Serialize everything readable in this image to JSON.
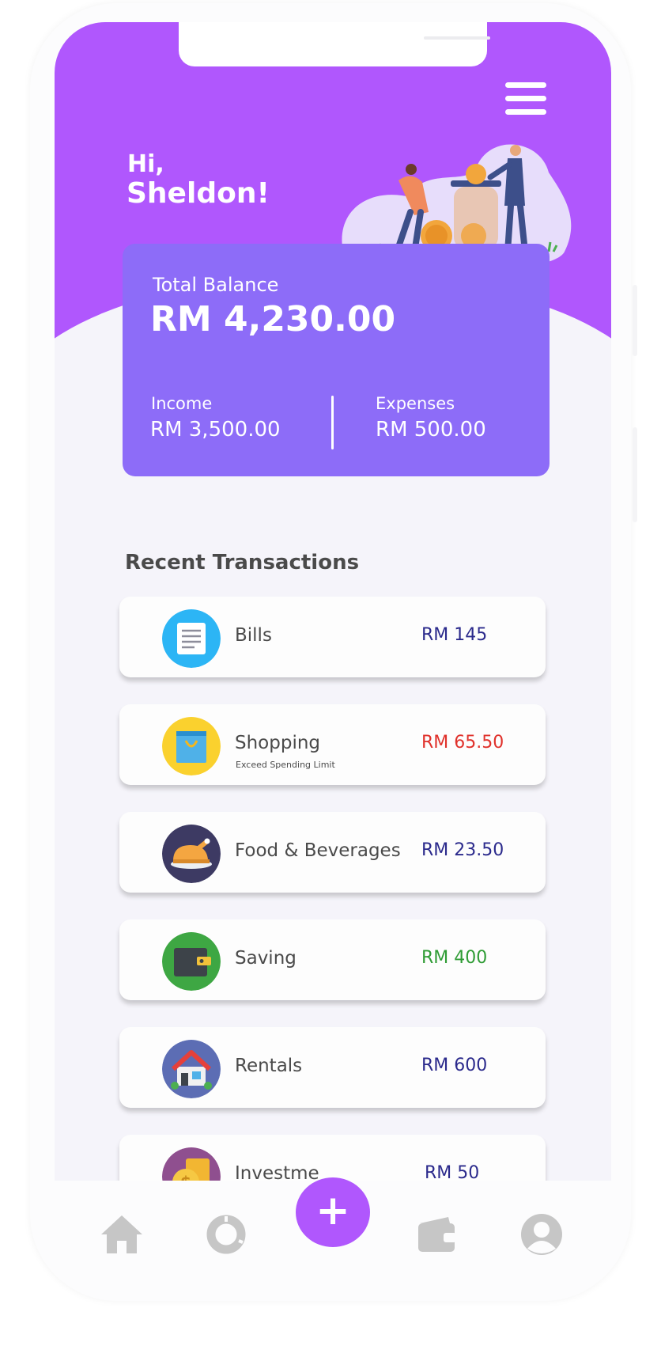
{
  "greeting": {
    "hi": "Hi,",
    "name": "Sheldon!"
  },
  "balance": {
    "label": "Total Balance",
    "value": "RM 4,230.00",
    "income_label": "Income",
    "income_value": "RM 3,500.00",
    "expenses_label": "Expenses",
    "expenses_value": "RM 500.00"
  },
  "recent": {
    "title": "Recent Transactions",
    "items": [
      {
        "name": "Bills",
        "amount": "RM 145",
        "amount_color": "#2b2a8c",
        "icon": "bills-icon",
        "icon_color": "#2cb5f5"
      },
      {
        "name": "Shopping",
        "sub": "Exceed Spending Limit",
        "amount": "RM 65.50",
        "amount_color": "#e0312b",
        "icon": "shopping-bag-icon",
        "icon_color": "#fad12e"
      },
      {
        "name": "Food & Beverages",
        "amount": "RM 23.50",
        "amount_color": "#2b2a8c",
        "icon": "roast-chicken-icon",
        "icon_color": "#3d3a63"
      },
      {
        "name": "Saving",
        "amount": "RM 400",
        "amount_color": "#2f9c35",
        "icon": "wallet-icon",
        "icon_color": "#3ea743"
      },
      {
        "name": "Rentals",
        "amount": "RM 600",
        "amount_color": "#2b2a8c",
        "icon": "house-icon",
        "icon_color": "#5c6db4"
      },
      {
        "name": "Investme",
        "amount": "RM 50",
        "amount_color": "#2b2a8c",
        "icon": "coin-stack-icon",
        "icon_color": "#8f4f8f"
      }
    ]
  },
  "tabs": [
    "home",
    "chart",
    "wallet",
    "profile"
  ],
  "fab_label": "+",
  "colors": {
    "accent": "#b057fd",
    "card": "#8d6cf8",
    "icon_gray": "#c6c6c6"
  }
}
